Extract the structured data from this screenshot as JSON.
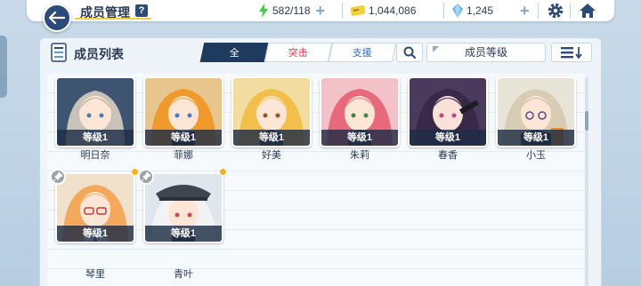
{
  "header": {
    "title": "成员管理",
    "help": "?",
    "stamina": "582/118",
    "credits": "1,044,086",
    "gems": "1,245"
  },
  "panel": {
    "title": "成员列表",
    "tabs": [
      {
        "label": "全"
      },
      {
        "label": "突击"
      },
      {
        "label": "支援"
      }
    ],
    "sort_label": "成员等级"
  },
  "members": [
    {
      "name": "明日奈",
      "level": "等级1"
    },
    {
      "name": "菲娜",
      "level": "等级1"
    },
    {
      "name": "好美",
      "level": "等级1"
    },
    {
      "name": "朱莉",
      "level": "等级1"
    },
    {
      "name": "春香",
      "level": "等级1"
    },
    {
      "name": "小玉",
      "level": "等级1"
    },
    {
      "name": "琴里",
      "level": "等级1"
    },
    {
      "name": "青叶",
      "level": "等级1"
    }
  ],
  "colors": {
    "accent": "#1f3a5f",
    "assault_tab": "#e0374a",
    "support_tab": "#2d6fc2",
    "new_dot": "#f5b324"
  },
  "icons": {
    "back": "back-arrow-icon",
    "stamina": "lightning-icon",
    "credits": "credit-ticket-icon",
    "gems": "gem-icon",
    "settings": "gear-icon",
    "home": "home-icon",
    "search": "search-icon",
    "sort": "sort-order-icon",
    "pin": "pin-icon"
  }
}
